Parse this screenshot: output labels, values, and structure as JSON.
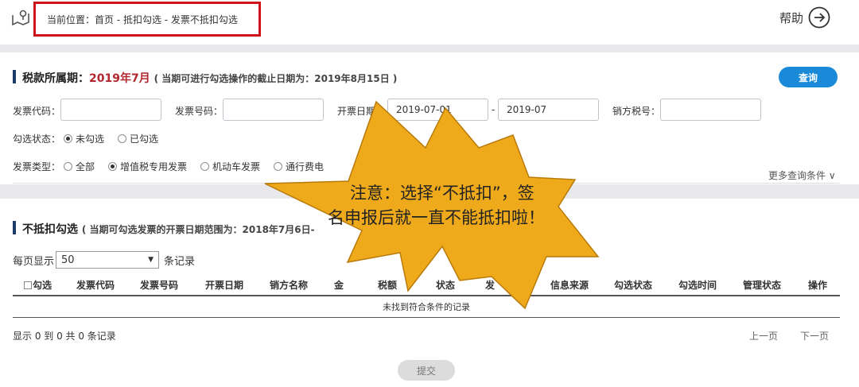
{
  "breadcrumb": "当前位置：首页 - 抵扣勾选 - 发票不抵扣勾选",
  "help_label": "帮助",
  "filter": {
    "period_label": "税款所属期：",
    "period_value": "2019年7月",
    "period_hint": "( 当期可进行勾选操作的截止日期为：2019年8月15日 )",
    "query_button": "查询",
    "invoice_code_label": "发票代码：",
    "invoice_no_label": "发票号码：",
    "date_label": "开票日期",
    "date_from": "2019-07-01",
    "date_sep": "-",
    "date_to": "2019-07",
    "seller_tax_label": "销方税号：",
    "status_label": "勾选状态：",
    "status_options": [
      "未勾选",
      "已勾选"
    ],
    "type_label": "发票类型：",
    "type_options": [
      "全部",
      "增值税专用发票",
      "机动车发票",
      "通行费电"
    ],
    "more": "更多查询条件 ∨"
  },
  "list": {
    "title": "不抵扣勾选",
    "hint": "( 当期可勾选发票的开票日期范围为：2018年7月6日-",
    "per_page_label": "每页显示",
    "per_page_value": "50",
    "per_page_suffix": "条记录",
    "columns": [
      "勾选",
      "发票代码",
      "发票号码",
      "开票日期",
      "销方名称",
      "金",
      "税额",
      "状态",
      "发",
      "信息来源",
      "勾选状态",
      "勾选时间",
      "管理状态",
      "操作"
    ],
    "empty_text": "未找到符合条件的记录",
    "info": "显示 0 到 0 共 0 条记录",
    "prev": "上一页",
    "next": "下一页",
    "submit": "提交"
  },
  "overlay": {
    "line1": "注意：选择“不抵扣”，签",
    "line2": "名申报后就一直不能抵扣啦！",
    "burst_color": "#efaa1c"
  }
}
